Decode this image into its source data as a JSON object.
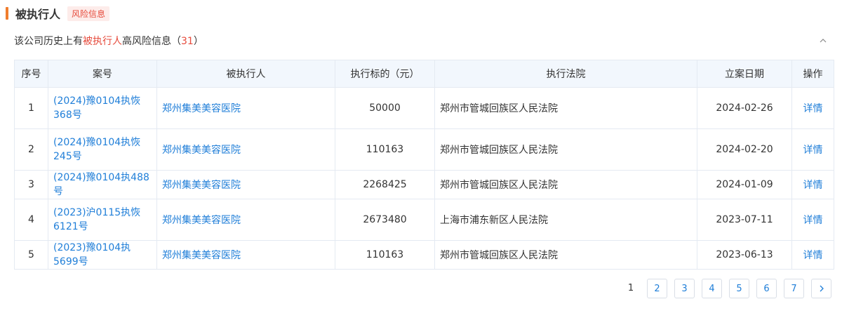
{
  "section": {
    "title": "被执行人",
    "tag": "风险信息"
  },
  "summary": {
    "prefix": "该公司历史上有",
    "highlight": "被执行人",
    "middle": "高风险信息（",
    "count": "31",
    "suffix": "）"
  },
  "table": {
    "headers": {
      "index": "序号",
      "case_no": "案号",
      "person": "被执行人",
      "amount": "执行标的（元）",
      "court": "执行法院",
      "date": "立案日期",
      "action": "操作"
    },
    "rows": [
      {
        "index": "1",
        "case_no": "(2024)豫0104执恢368号",
        "person": "郑州集美美容医院",
        "amount": "50000",
        "court": "郑州市管城回族区人民法院",
        "date": "2024-02-26",
        "action": "详情"
      },
      {
        "index": "2",
        "case_no": "(2024)豫0104执恢245号",
        "person": "郑州集美美容医院",
        "amount": "110163",
        "court": "郑州市管城回族区人民法院",
        "date": "2024-02-20",
        "action": "详情"
      },
      {
        "index": "3",
        "case_no": "(2024)豫0104执488号",
        "person": "郑州集美美容医院",
        "amount": "2268425",
        "court": "郑州市管城回族区人民法院",
        "date": "2024-01-09",
        "action": "详情"
      },
      {
        "index": "4",
        "case_no": "(2023)沪0115执恢6121号",
        "person": "郑州集美美容医院",
        "amount": "2673480",
        "court": "上海市浦东新区人民法院",
        "date": "2023-07-11",
        "action": "详情"
      },
      {
        "index": "5",
        "case_no": "(2023)豫0104执5699号",
        "person": "郑州集美美容医院",
        "amount": "110163",
        "court": "郑州市管城回族区人民法院",
        "date": "2023-06-13",
        "action": "详情"
      }
    ]
  },
  "pagination": {
    "current": "1",
    "pages": [
      "2",
      "3",
      "4",
      "5",
      "6",
      "7"
    ]
  },
  "icons": {
    "collapse": "chevron-up-icon",
    "next": "chevron-right-icon"
  },
  "colors": {
    "accent": "#f07d2d",
    "risk": "#e64b3c",
    "link": "#1f7ed8",
    "header_bg": "#f2f7fd"
  }
}
